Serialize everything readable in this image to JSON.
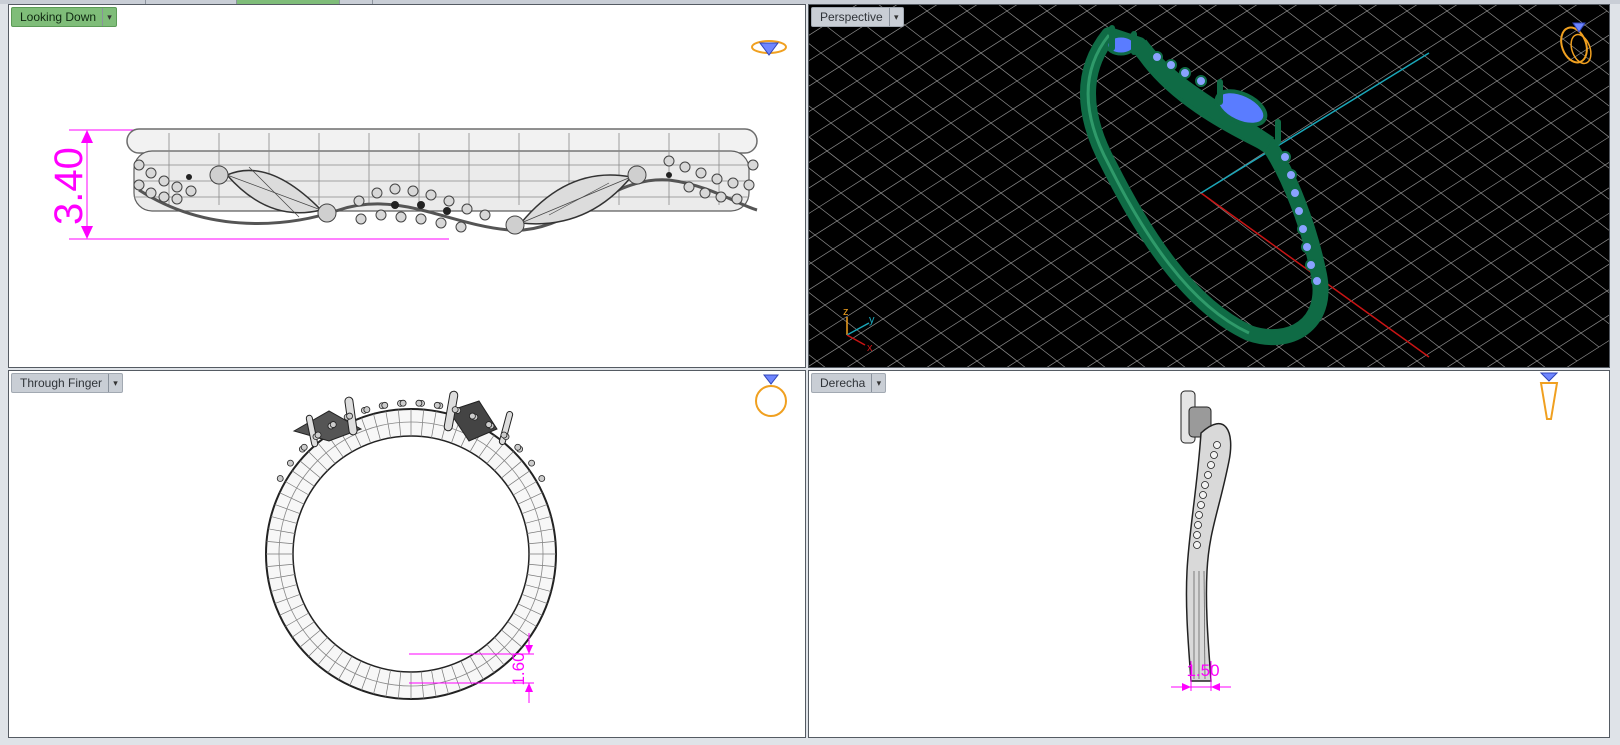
{
  "viewports": {
    "top_left": {
      "label": "Looking Down",
      "active": true,
      "dimension": "3.40"
    },
    "top_right": {
      "label": "Perspective",
      "active": false,
      "axis_x": "x",
      "axis_y": "y",
      "axis_z": "z"
    },
    "bottom_left": {
      "label": "Through Finger",
      "active": false,
      "dimension": "1.60"
    },
    "bottom_right": {
      "label": "Derecha",
      "active": false,
      "dimension": "1.50"
    }
  },
  "colors": {
    "active_label_bg": "#7fbd79",
    "dimension": "#ff00ff",
    "gold_icon": "#f0a020",
    "gem_blue": "#5a7cff",
    "ring_green": "#0f6b45",
    "axis_red": "#c81414",
    "axis_cyan": "#1aa6b8"
  }
}
